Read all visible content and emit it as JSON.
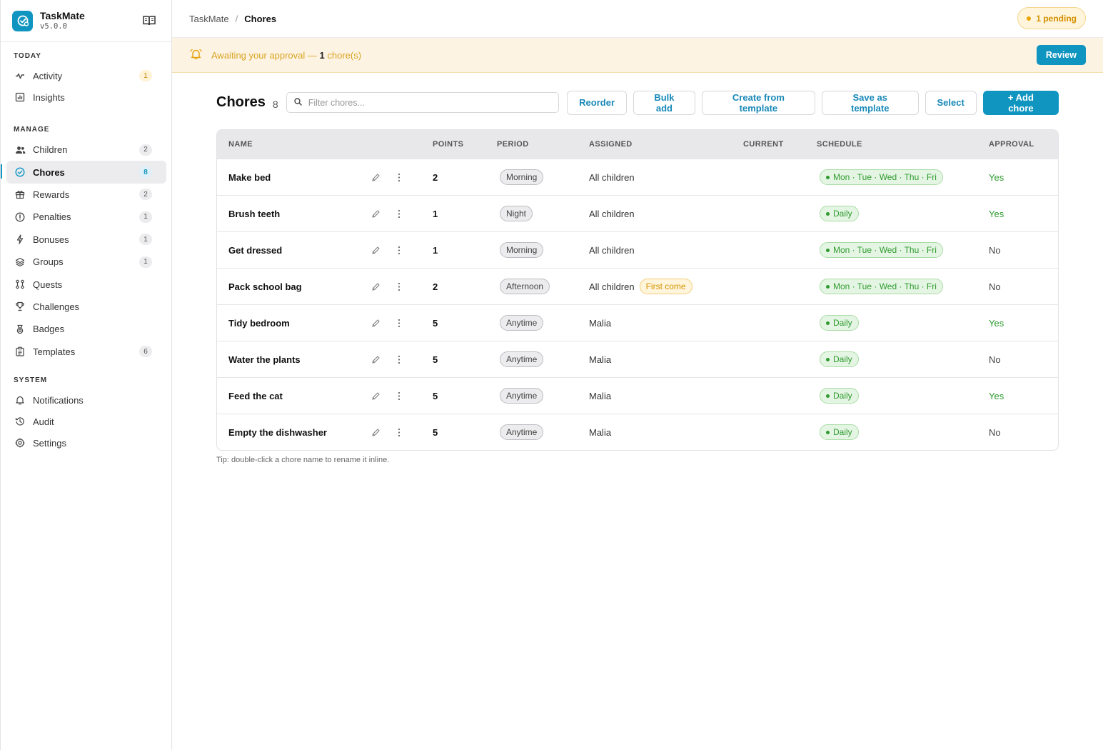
{
  "brand": {
    "name": "TaskMate",
    "version": "v5.0.0"
  },
  "sidebar": {
    "sections": [
      {
        "title": "TODAY",
        "items": [
          {
            "key": "activity",
            "label": "Activity",
            "icon": "activity-icon",
            "count": "1",
            "count_style": "warn"
          },
          {
            "key": "insights",
            "label": "Insights",
            "icon": "chart-icon",
            "count": ""
          }
        ]
      },
      {
        "title": "MANAGE",
        "items": [
          {
            "key": "children",
            "label": "Children",
            "icon": "users-icon",
            "count": "2"
          },
          {
            "key": "chores",
            "label": "Chores",
            "icon": "check-circle-icon",
            "count": "8",
            "active": true,
            "count_style": "info"
          },
          {
            "key": "rewards",
            "label": "Rewards",
            "icon": "gift-icon",
            "count": "2"
          },
          {
            "key": "penalties",
            "label": "Penalties",
            "icon": "alert-circle-icon",
            "count": "1"
          },
          {
            "key": "bonuses",
            "label": "Bonuses",
            "icon": "bolt-icon",
            "count": "1"
          },
          {
            "key": "groups",
            "label": "Groups",
            "icon": "layers-icon",
            "count": "1"
          },
          {
            "key": "quests",
            "label": "Quests",
            "icon": "route-icon",
            "count": ""
          },
          {
            "key": "challenges",
            "label": "Challenges",
            "icon": "trophy-icon",
            "count": ""
          },
          {
            "key": "badges",
            "label": "Badges",
            "icon": "medal-icon",
            "count": ""
          },
          {
            "key": "templates",
            "label": "Templates",
            "icon": "clipboard-icon",
            "count": "6"
          }
        ]
      },
      {
        "title": "SYSTEM",
        "items": [
          {
            "key": "notifications",
            "label": "Notifications",
            "icon": "bell-icon",
            "count": ""
          },
          {
            "key": "audit",
            "label": "Audit",
            "icon": "history-icon",
            "count": ""
          },
          {
            "key": "settings",
            "label": "Settings",
            "icon": "gear-icon",
            "count": ""
          }
        ]
      }
    ]
  },
  "topbar": {
    "breadcrumb_home": "TaskMate",
    "breadcrumb_sep": "/",
    "breadcrumb_current": "Chores",
    "pending_label": "1 pending"
  },
  "banner": {
    "text_prefix": "Awaiting your approval — ",
    "count": "1",
    "text_suffix": " chore(s)",
    "review_label": "Review"
  },
  "page": {
    "title": "Chores",
    "count": "8",
    "filter_placeholder": "Filter chores...",
    "buttons": {
      "reorder": "Reorder",
      "bulk_add": "Bulk add",
      "create_from_template": "Create from template",
      "save_as_template": "Save as template",
      "select": "Select",
      "add_chore": "+ Add chore"
    }
  },
  "table": {
    "headers": {
      "name": "NAME",
      "points": "POINTS",
      "period": "PERIOD",
      "assigned": "ASSIGNED",
      "current": "CURRENT",
      "schedule": "SCHEDULE",
      "approval": "APPROVAL"
    },
    "rows": [
      {
        "name": "Make bed",
        "points": "2",
        "period": "Morning",
        "assigned": "All children",
        "tag": "",
        "schedule": "Mon · Tue · Wed · Thu · Fri",
        "approval": "Yes"
      },
      {
        "name": "Brush teeth",
        "points": "1",
        "period": "Night",
        "assigned": "All children",
        "tag": "",
        "schedule": "Daily",
        "approval": "Yes"
      },
      {
        "name": "Get dressed",
        "points": "1",
        "period": "Morning",
        "assigned": "All children",
        "tag": "",
        "schedule": "Mon · Tue · Wed · Thu · Fri",
        "approval": "No"
      },
      {
        "name": "Pack school bag",
        "points": "2",
        "period": "Afternoon",
        "assigned": "All children",
        "tag": "First come",
        "schedule": "Mon · Tue · Wed · Thu · Fri",
        "approval": "No"
      },
      {
        "name": "Tidy bedroom",
        "points": "5",
        "period": "Anytime",
        "assigned": "Malia",
        "tag": "",
        "schedule": "Daily",
        "approval": "Yes"
      },
      {
        "name": "Water the plants",
        "points": "5",
        "period": "Anytime",
        "assigned": "Malia",
        "tag": "",
        "schedule": "Daily",
        "approval": "No"
      },
      {
        "name": "Feed the cat",
        "points": "5",
        "period": "Anytime",
        "assigned": "Malia",
        "tag": "",
        "schedule": "Daily",
        "approval": "Yes"
      },
      {
        "name": "Empty the dishwasher",
        "points": "5",
        "period": "Anytime",
        "assigned": "Malia",
        "tag": "",
        "schedule": "Daily",
        "approval": "No"
      }
    ]
  },
  "tip": "Tip: double-click a chore name to rename it inline.",
  "colors": {
    "accent": "#1095c1",
    "warning": "#d9a422",
    "success": "#2e9b2e"
  }
}
